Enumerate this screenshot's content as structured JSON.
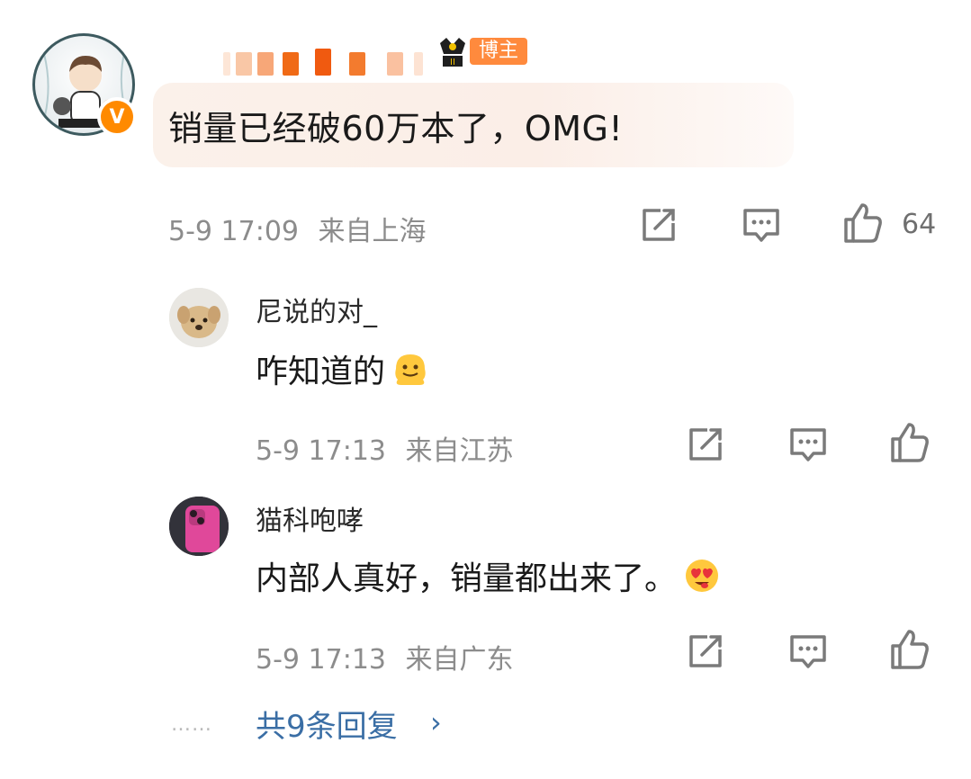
{
  "main_comment": {
    "author_name_masked": "",
    "role_badge": "博主",
    "verified_badge": "V",
    "text": "销量已经破60万本了，OMG!",
    "timestamp": "5-9 17:09",
    "location": "来自上海",
    "likes": "64",
    "icons": [
      "share-icon",
      "comment-icon",
      "like-icon"
    ]
  },
  "replies": [
    {
      "author": "尼说的对_",
      "text": "咋知道的",
      "emoji": "melting-face-emoji",
      "timestamp": "5-9 17:13",
      "location": "来自江苏"
    },
    {
      "author": "猫科咆哮",
      "text": "内部人真好，销量都出来了。",
      "emoji": "heart-eyes-emoji",
      "timestamp": "5-9 17:13",
      "location": "来自广东"
    }
  ],
  "more": {
    "dots": "……",
    "label": "共9条回复",
    "chevron": "›"
  },
  "colors": {
    "accent_link": "#3a6ea5",
    "badge_orange": "#ff8a3d",
    "verified_orange": "#ff8a00",
    "bubble_bg": "#fbf1ea",
    "meta_gray": "#8c8c8c"
  }
}
